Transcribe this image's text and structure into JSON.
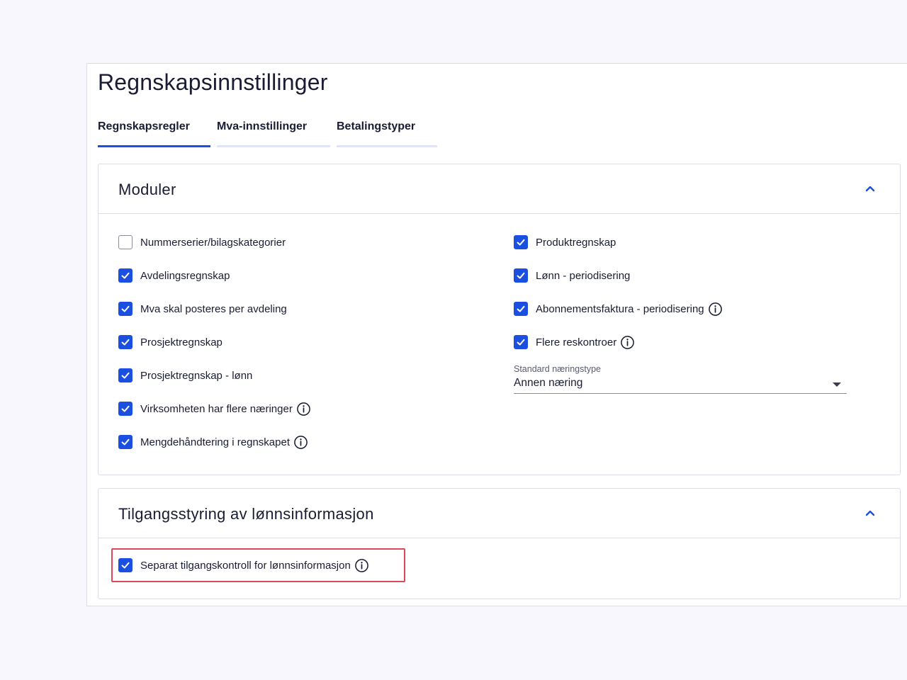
{
  "page": {
    "title": "Regnskapsinnstillinger"
  },
  "tabs": [
    {
      "label": "Regnskapsregler",
      "active": true
    },
    {
      "label": "Mva-innstillinger",
      "active": false
    },
    {
      "label": "Betalingstyper",
      "active": false
    }
  ],
  "modules": {
    "title": "Moduler",
    "left": [
      {
        "label": "Nummerserier/bilagskategorier",
        "checked": false,
        "info": false
      },
      {
        "label": "Avdelingsregnskap",
        "checked": true,
        "info": false
      },
      {
        "label": "Mva skal posteres per avdeling",
        "checked": true,
        "info": false
      },
      {
        "label": "Prosjektregnskap",
        "checked": true,
        "info": false
      },
      {
        "label": "Prosjektregnskap - lønn",
        "checked": true,
        "info": false
      },
      {
        "label": "Virksomheten har flere næringer",
        "checked": true,
        "info": true
      },
      {
        "label": "Mengdehåndtering i regnskapet",
        "checked": true,
        "info": true
      }
    ],
    "right": [
      {
        "label": "Produktregnskap",
        "checked": true,
        "info": false
      },
      {
        "label": "Lønn - periodisering",
        "checked": true,
        "info": false
      },
      {
        "label": "Abonnementsfaktura - periodisering",
        "checked": true,
        "info": true
      },
      {
        "label": "Flere reskontroer",
        "checked": true,
        "info": true
      }
    ],
    "industry_select": {
      "label": "Standard næringstype",
      "value": "Annen næring"
    }
  },
  "salary_access": {
    "title": "Tilgangsstyring av lønnsinformasjon",
    "option": {
      "label": "Separat tilgangskontroll for lønnsinformasjon",
      "checked": true,
      "info": true
    }
  },
  "colors": {
    "accent": "#1a4fe0",
    "highlight": "#e0465a",
    "background": "#f7f7fd"
  }
}
